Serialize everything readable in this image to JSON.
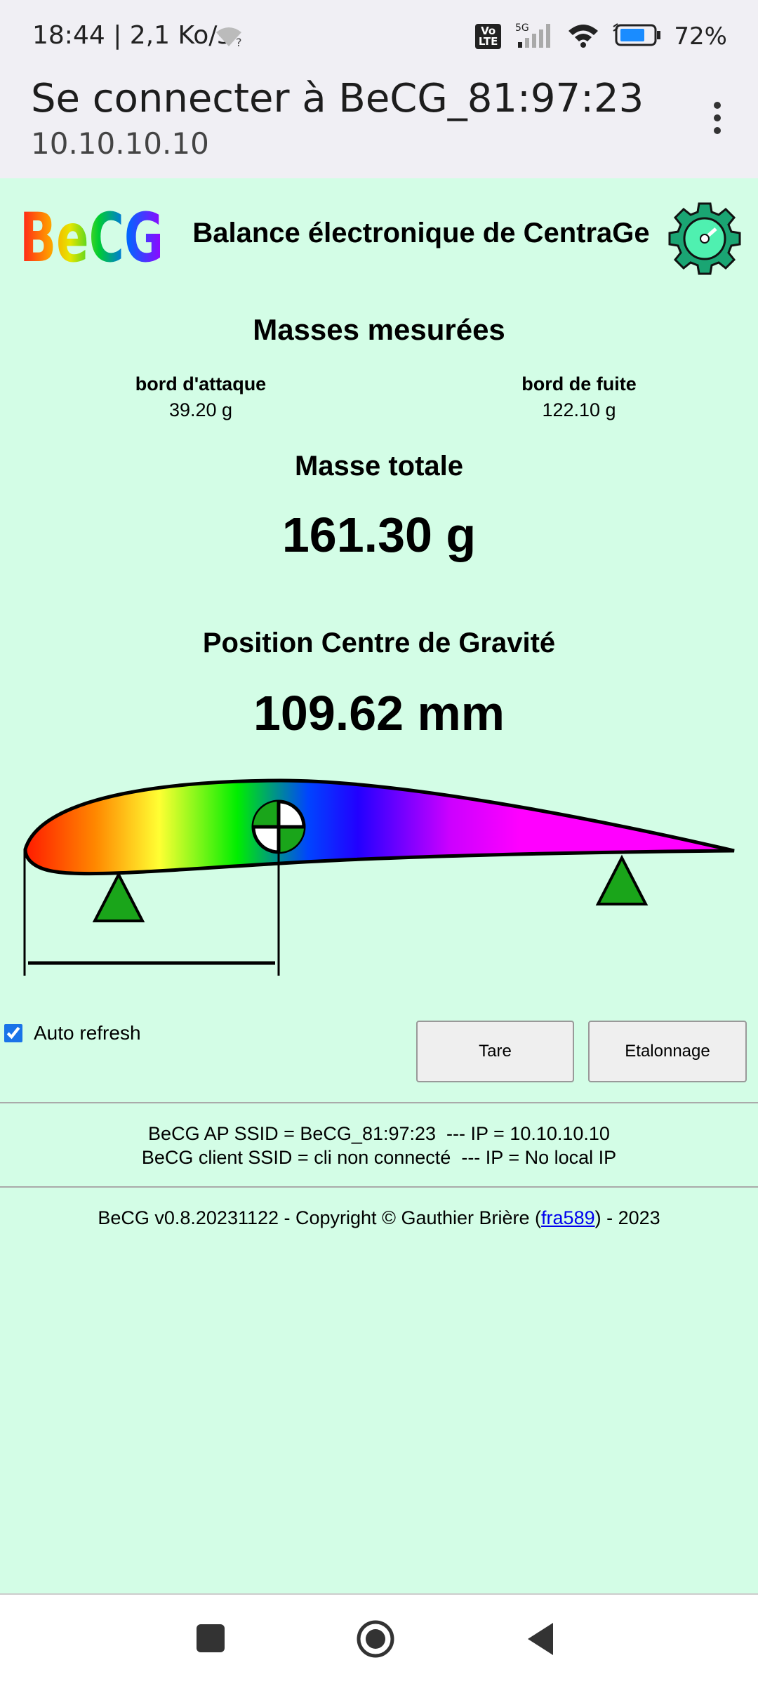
{
  "status": {
    "time_speed": "18:44 | 2,1 Ko/s",
    "network_label": "5G",
    "volte_label": "Vo\nLTE",
    "battery": "72%"
  },
  "header": {
    "title": "Se connecter à BeCG_81:97:23",
    "subtitle": "10.10.10.10"
  },
  "app": {
    "logo_text": "BeCG",
    "title": "Balance électronique de CentraGe"
  },
  "masses": {
    "heading": "Masses mesurées",
    "leading_label": "bord d'attaque",
    "leading_value": "39.20 g",
    "trailing_label": "bord de fuite",
    "trailing_value": "122.10 g"
  },
  "total": {
    "heading": "Masse totale",
    "value": "161.30 g"
  },
  "cg": {
    "heading": "Position Centre de Gravité",
    "value": "109.62 mm"
  },
  "controls": {
    "auto_refresh_label": "Auto refresh",
    "auto_refresh_checked": true,
    "tare_label": "Tare",
    "calibration_label": "Etalonnage"
  },
  "info": {
    "ap_line": "BeCG AP SSID = BeCG_81:97:23  --- IP = 10.10.10.10",
    "client_line": "BeCG client SSID = cli non connecté  --- IP = No local IP"
  },
  "footer": {
    "prefix": "BeCG v0.8.20231122 - Copyright © Gauthier Brière (",
    "link": "fra589",
    "suffix": ") - 2023"
  },
  "colors": {
    "background": "#d3fde6",
    "support": "#1aa51a",
    "gear": "#1aa573"
  },
  "icons": [
    "wifi-icon",
    "signal-icon",
    "battery-icon",
    "more-vert-icon",
    "gear-gauge-icon",
    "cg-target-icon",
    "support-triangle-icon",
    "recent-apps-icon",
    "home-icon",
    "back-icon"
  ]
}
